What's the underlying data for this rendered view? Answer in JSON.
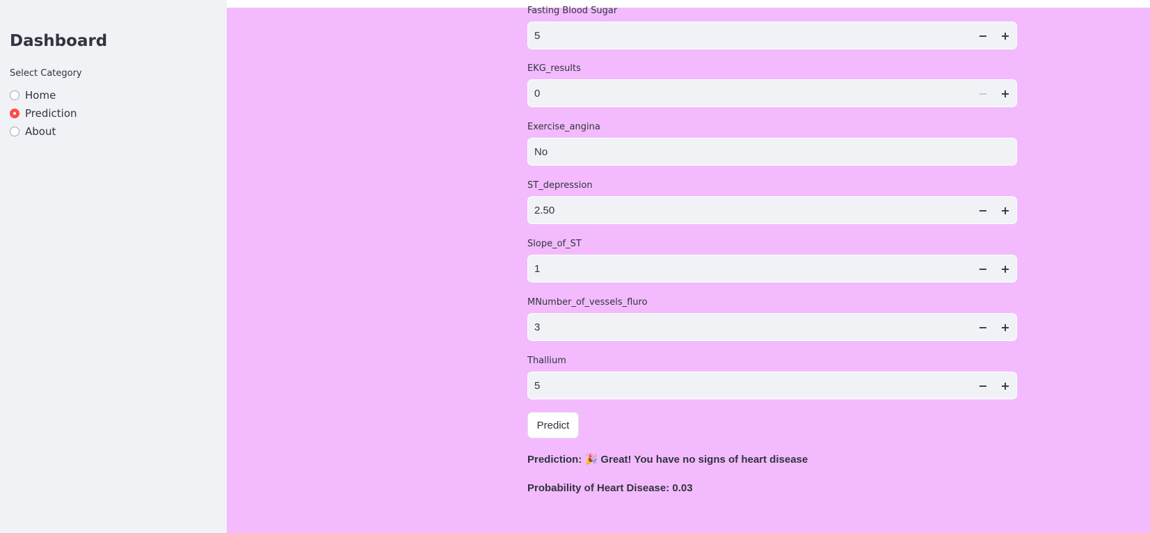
{
  "sidebar": {
    "title": "Dashboard",
    "radio_label": "Select Category",
    "options": [
      {
        "label": "Home",
        "selected": false
      },
      {
        "label": "Prediction",
        "selected": true
      },
      {
        "label": "About",
        "selected": false
      }
    ]
  },
  "fields": [
    {
      "label": "Fasting Blood Sugar",
      "value": "5",
      "stepper": true
    },
    {
      "label": "EKG_results",
      "value": "0",
      "stepper": true,
      "minus_disabled": true
    },
    {
      "label": "Exercise_angina",
      "value": "No",
      "stepper": false
    },
    {
      "label": "ST_depression",
      "value": "2.50",
      "stepper": true
    },
    {
      "label": "Slope_of_ST",
      "value": "1",
      "stepper": true
    },
    {
      "label": "MNumber_of_vessels_fluro",
      "value": "3",
      "stepper": true
    },
    {
      "label": "Thallium",
      "value": "5",
      "stepper": true
    }
  ],
  "predict_button": "Predict",
  "result": {
    "prediction": "Prediction: 🎉 Great! You have no signs of heart disease",
    "probability": "Probability of Heart Disease: 0.03"
  },
  "icons": {
    "minus": "−",
    "plus": "+"
  },
  "colors": {
    "main_background": "#f3bbfd",
    "sidebar_background": "#f0f2f6",
    "accent": "#ff4b4b"
  }
}
